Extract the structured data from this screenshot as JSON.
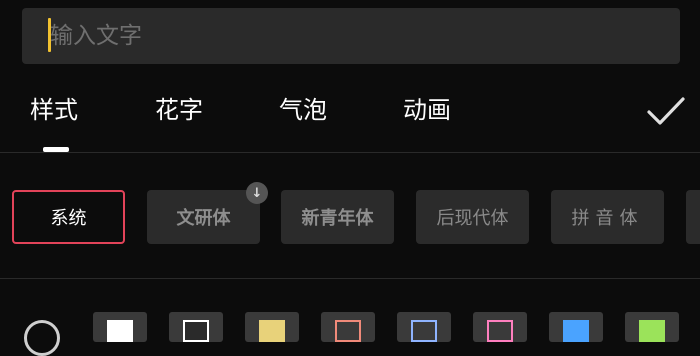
{
  "input": {
    "placeholder": "输入文字",
    "value": ""
  },
  "tabs": [
    {
      "label": "样式",
      "active": true
    },
    {
      "label": "花字",
      "active": false
    },
    {
      "label": "气泡",
      "active": false
    },
    {
      "label": "动画",
      "active": false
    }
  ],
  "confirm": {
    "icon": "checkmark-icon"
  },
  "fonts": [
    {
      "label": "系统",
      "selected": true,
      "downloadable": false
    },
    {
      "label": "文研体",
      "selected": false,
      "downloadable": true
    },
    {
      "label": "新青年体",
      "selected": false,
      "downloadable": false
    },
    {
      "label": "后现代体",
      "selected": false,
      "downloadable": false
    },
    {
      "label": "拼音体",
      "selected": false,
      "downloadable": false
    }
  ],
  "swatches": [
    {
      "name": "none",
      "icon": "no-style-icon"
    },
    {
      "fill": "#ffffff",
      "border": "#ffffff"
    },
    {
      "fill": "#2a2a2a",
      "border": "#ffffff"
    },
    {
      "fill": "#e8d27a",
      "border": "#e8d27a"
    },
    {
      "fill": "#3a3a3a",
      "border": "#f08a7a"
    },
    {
      "fill": "#3a3a3a",
      "border": "#8fb4ff"
    },
    {
      "fill": "#3a3a3a",
      "border": "#ff7fbf"
    },
    {
      "fill": "#4aa3ff",
      "border": "#4aa3ff"
    },
    {
      "fill": "#9be35a",
      "border": "#9be35a"
    }
  ],
  "colors": {
    "accent_selected": "#e24359",
    "caret": "#f2c230",
    "background": "#0c0c0c",
    "chip": "#2b2b2b"
  }
}
